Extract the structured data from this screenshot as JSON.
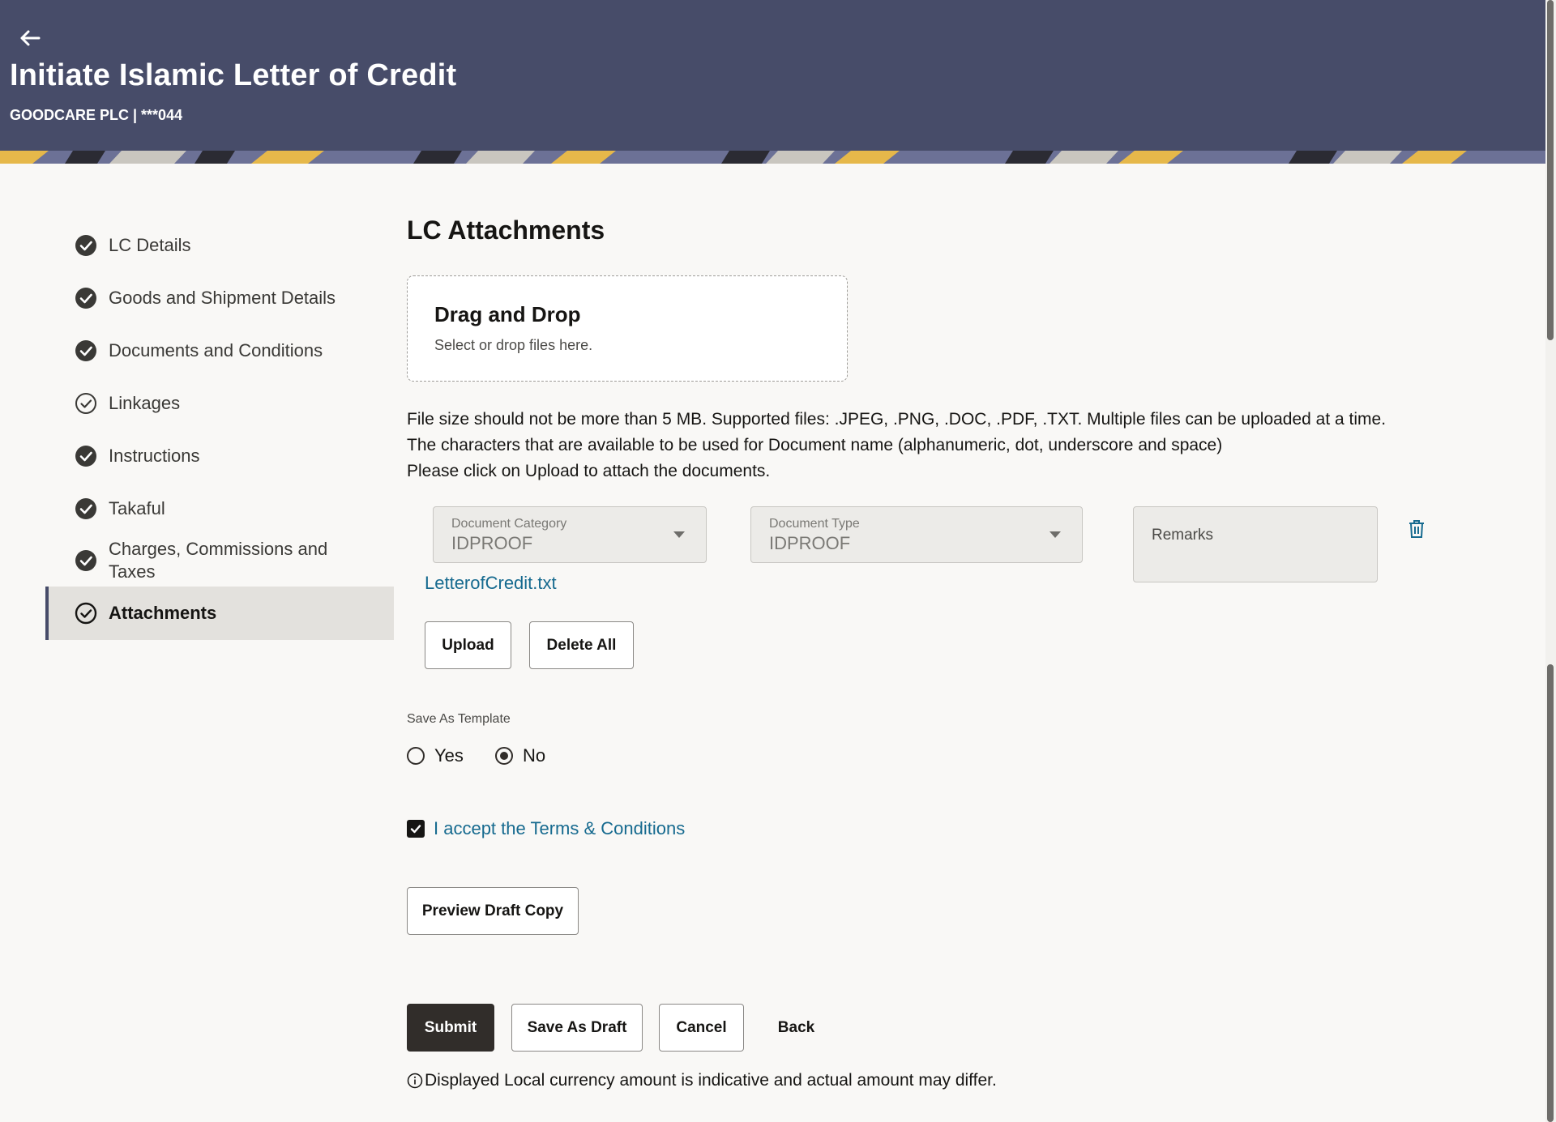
{
  "header": {
    "title": "Initiate Islamic Letter of Credit",
    "subtitle": "GOODCARE PLC | ***044"
  },
  "sidebar": {
    "steps": [
      {
        "label": "LC Details",
        "status": "complete"
      },
      {
        "label": "Goods and Shipment Details",
        "status": "complete"
      },
      {
        "label": "Documents and Conditions",
        "status": "complete"
      },
      {
        "label": "Linkages",
        "status": "outline"
      },
      {
        "label": "Instructions",
        "status": "complete"
      },
      {
        "label": "Takaful",
        "status": "complete"
      },
      {
        "label": "Charges, Commissions and Taxes",
        "status": "complete"
      },
      {
        "label": "Attachments",
        "status": "active"
      }
    ]
  },
  "main": {
    "title": "LC Attachments",
    "dropzone": {
      "title": "Drag and Drop",
      "subtitle": "Select or drop files here."
    },
    "info_lines": [
      "File size should not be more than 5 MB. Supported files: .JPEG, .PNG, .DOC, .PDF, .TXT. Multiple files can be uploaded at a time.",
      "The characters that are available to be used for Document name (alphanumeric, dot, underscore and space)",
      "Please click on Upload to attach the documents."
    ],
    "document_category": {
      "label": "Document Category",
      "value": "IDPROOF"
    },
    "document_type": {
      "label": "Document Type",
      "value": "IDPROOF"
    },
    "remarks": {
      "label": "Remarks"
    },
    "file_name": "LetterofCredit.txt",
    "upload_label": "Upload",
    "delete_all_label": "Delete All",
    "save_as_template": {
      "label": "Save As Template",
      "options": [
        "Yes",
        "No"
      ],
      "selected": "No"
    },
    "terms": {
      "text": "I accept the Terms & Conditions",
      "checked": true
    },
    "preview_label": "Preview Draft Copy",
    "actions": {
      "submit": "Submit",
      "save_draft": "Save As Draft",
      "cancel": "Cancel",
      "back": "Back"
    },
    "note": "Displayed Local currency amount is indicative and actual amount may differ."
  },
  "colors": {
    "header_bg": "#474c69",
    "link": "#166a8f",
    "primary_button": "#312d2a",
    "active_step_bg": "#e3e1dd"
  }
}
